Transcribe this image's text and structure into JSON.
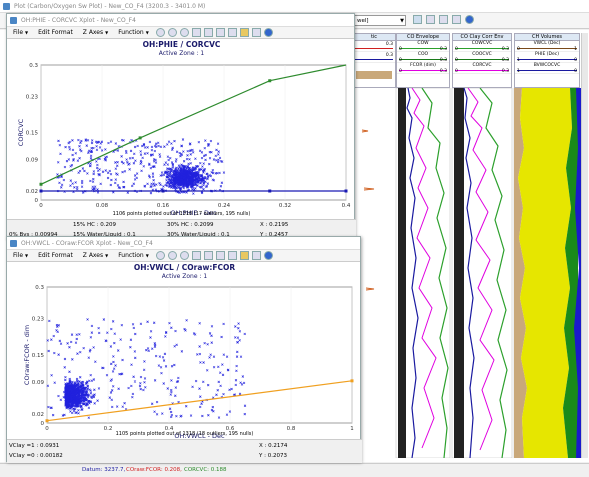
{
  "main_window": {
    "title": "Plot (Carbon/Oxygen Sw Plot) - New_CO_F4 (3200.3 - 3401.0 M)",
    "dropdown_value": "wel]",
    "status": {
      "datum": "Datum: 3237.7,",
      "coraw": "COraw:FCOR: 0.208,",
      "corcvc": "CORCVC: 0.188"
    }
  },
  "tracks": [
    {
      "title": "CO Envelope",
      "legend": [
        {
          "name": "COW",
          "lo": "0",
          "hi": "0.3",
          "color": "#2ca02c"
        },
        {
          "name": "COO",
          "lo": "0",
          "hi": "0.3",
          "color": "#1a7a1a"
        },
        {
          "name": "FCOR (dim)",
          "lo": "0",
          "hi": "0.3",
          "color": "#e000e0"
        }
      ]
    },
    {
      "title": "CO Clay Corr Env",
      "legend": [
        {
          "name": "COWCVC",
          "lo": "0",
          "hi": "0.3",
          "color": "#2ca02c"
        },
        {
          "name": "COOCVC",
          "lo": "0",
          "hi": "0.3",
          "color": "#1a7a1a"
        },
        {
          "name": "CORCVC",
          "lo": "0",
          "hi": "0.3",
          "color": "#e000e0"
        }
      ]
    },
    {
      "title": "CH Volumes",
      "legend": [
        {
          "name": "VWCL (Dec)",
          "lo": "0",
          "hi": "1",
          "color": "#7a4a1a"
        },
        {
          "name": "PHIE (Dec)",
          "lo": "1",
          "hi": "0",
          "color": "#1a1aa0"
        },
        {
          "name": "BVWCOCVC",
          "lo": "1",
          "hi": "0",
          "color": "#1a1aa0"
        }
      ]
    }
  ],
  "partial_track": {
    "title": "tic",
    "values": [
      "0.3",
      "0.3"
    ]
  },
  "menu": {
    "file": "File",
    "edit_format": "Edit Format",
    "z_axes": "Z Axes",
    "function": "Function"
  },
  "xplot1": {
    "title": "OH:PHIE - CORCVC Xplot - New_CO_F4",
    "chart_title": "OH:PHIE / CORCVC",
    "zone": "Active Zone : 1",
    "points_info": "1106 points plotted out of 1318 (17 outliers, 195 nulls)",
    "status_rows": [
      [
        "15% HC : 0.209",
        "30% HC : 0.2099",
        "X : 0.2195"
      ],
      [
        "0% Bvs : 0.00994",
        "15% Water/Liquid : 0.1",
        "30% Water/Liquid : 0.1",
        "Y : 0.2457"
      ]
    ]
  },
  "xplot2": {
    "title": "OH:VWCL - COraw:FCOR Xplot - New_CO_F4",
    "chart_title": "OH:VWCL / COraw:FCOR",
    "zone": "Active Zone : 1",
    "points_info": "1105 points plotted out of 1318 (18 outliers, 195 nulls)",
    "status_rows": [
      [
        "VClay =1 : 0.0931",
        "X : 0.2174"
      ],
      [
        "VClay =0 : 0.00182",
        "Y : 0.2073"
      ]
    ]
  },
  "chart_data": [
    {
      "type": "scatter",
      "title": "OH:PHIE / CORCVC",
      "xlabel": "OH:PHIE - Dec",
      "ylabel": "CORCVC",
      "xlim": [
        0,
        0.4
      ],
      "ylim": [
        0,
        0.3
      ],
      "xticks": [
        "0",
        "0.08",
        "0.16",
        "0.24",
        "0.32",
        "0.4"
      ],
      "yticks": [
        "0",
        "0.02",
        "0.09",
        "0.15",
        "0.23",
        "0.3"
      ],
      "point_count": 1106,
      "lines": [
        {
          "color": "#2e8b2e",
          "points": [
            [
              0,
              0.035
            ],
            [
              0.13,
              0.138
            ],
            [
              0.3,
              0.265
            ],
            [
              0.4,
              0.345
            ]
          ]
        },
        {
          "color": "#1a1ab4",
          "points": [
            [
              0,
              0.02
            ],
            [
              0.16,
              0.02
            ],
            [
              0.3,
              0.02
            ],
            [
              0.4,
              0.02
            ]
          ]
        }
      ]
    },
    {
      "type": "scatter",
      "title": "OH:VWCL / COraw:FCOR",
      "xlabel": "OH:VWCL - Dec",
      "ylabel": "COraw:FCOR - dim",
      "xlim": [
        0,
        1
      ],
      "ylim": [
        0,
        0.3
      ],
      "xticks": [
        "0",
        "0.2",
        "0.4",
        "0.6",
        "0.8",
        "1"
      ],
      "yticks": [
        "0",
        "0.02",
        "0.09",
        "0.15",
        "0.23",
        "0.3"
      ],
      "point_count": 1105,
      "lines": [
        {
          "color": "#f0a020",
          "points": [
            [
              0,
              0.005
            ],
            [
              1,
              0.093
            ]
          ]
        }
      ]
    }
  ]
}
